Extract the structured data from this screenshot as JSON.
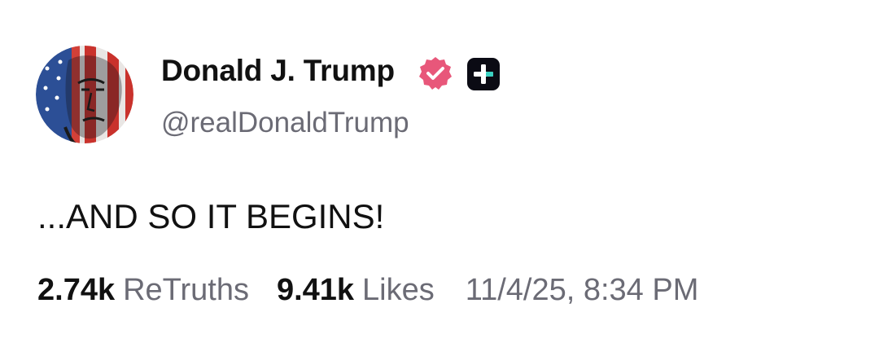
{
  "author": {
    "display_name": "Donald J. Trump",
    "handle": "@realDonaldTrump",
    "avatar_icon": "avatar-flag-portrait",
    "verified_icon": "verified-badge-icon",
    "plus_icon": "plus-badge-icon"
  },
  "post": {
    "text": "...AND SO IT BEGINS!"
  },
  "stats": {
    "retruths_count": "2.74k",
    "retruths_label": "ReTruths",
    "likes_count": "9.41k",
    "likes_label": "Likes",
    "timestamp": "11/4/25, 8:34 PM"
  },
  "colors": {
    "text_primary": "#111111",
    "text_secondary": "#6b6b75",
    "verified_pink": "#e8577a",
    "plus_badge_bg": "#0b0b14",
    "plus_badge_accent": "#3ad1c2"
  }
}
